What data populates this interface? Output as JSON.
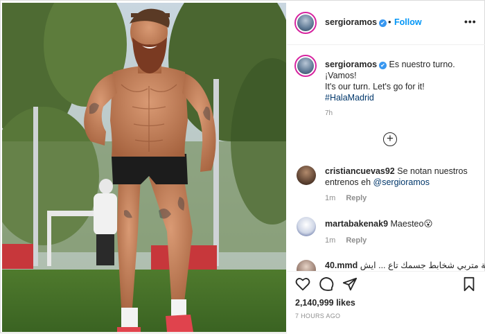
{
  "post": {
    "photo": {
      "alt_subject": "player-photo"
    },
    "header": {
      "username": "sergioramos",
      "verified_mark": "✔",
      "separator": "•",
      "follow_label": "Follow",
      "more_label": "•••"
    },
    "caption": {
      "username": "sergioramos",
      "verified_mark": "✔",
      "lines": [
        "Es nuestro turno.",
        "¡Vamos!",
        "It's our turn. Let's go for it!"
      ],
      "hashtag": "#HalaMadrid",
      "time": "7h"
    },
    "load_more_label": "+",
    "comments": [
      {
        "username": "cristiancuevas92",
        "text": "Se notan nuestros entrenos eh",
        "mention": "@sergioramos",
        "time": "1m",
        "reply_label": "Reply"
      },
      {
        "username": "martabakenak9",
        "text": "Maesteo",
        "emoji": "😮",
        "time": "1m",
        "reply_label": "Reply"
      },
      {
        "username": "40.mmd",
        "text": "الوصية متربي شخابط جسمك تاع ... ايش"
      }
    ],
    "actions": {
      "icons": [
        "heart-icon",
        "comment-icon",
        "share-icon",
        "bookmark-icon"
      ],
      "likes": "2,140,999 likes",
      "posted_ago": "7 HOURS AGO"
    }
  }
}
